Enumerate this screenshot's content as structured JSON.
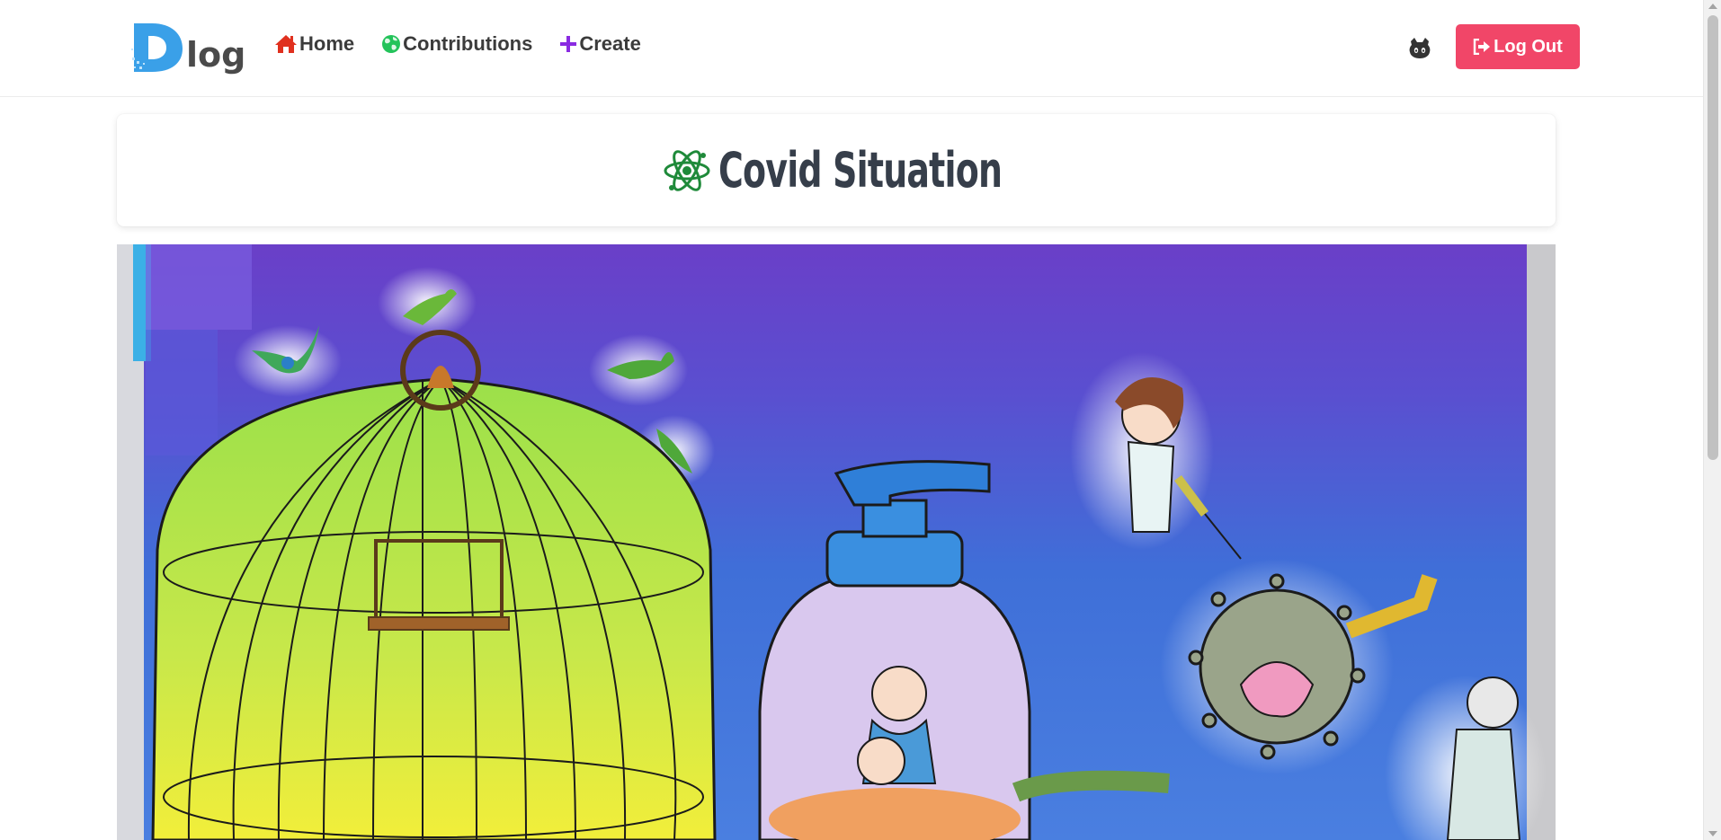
{
  "navbar": {
    "logo_text": "log",
    "links": [
      {
        "label": "Home",
        "icon": "home-icon",
        "color": "#e0301e"
      },
      {
        "label": "Contributions",
        "icon": "globe-icon",
        "color": "#23d160"
      },
      {
        "label": "Create",
        "icon": "plus-icon",
        "color": "#8a2be2"
      }
    ],
    "github_icon": "github-icon",
    "logout_label": "Log Out",
    "logout_color": "#f14668"
  },
  "post": {
    "title": "Covid Situation",
    "title_icon": "atom-icon"
  },
  "colors": {
    "accent": "#f14668",
    "title_text": "#363e4a",
    "logo_blue": "#3aa0e8"
  }
}
